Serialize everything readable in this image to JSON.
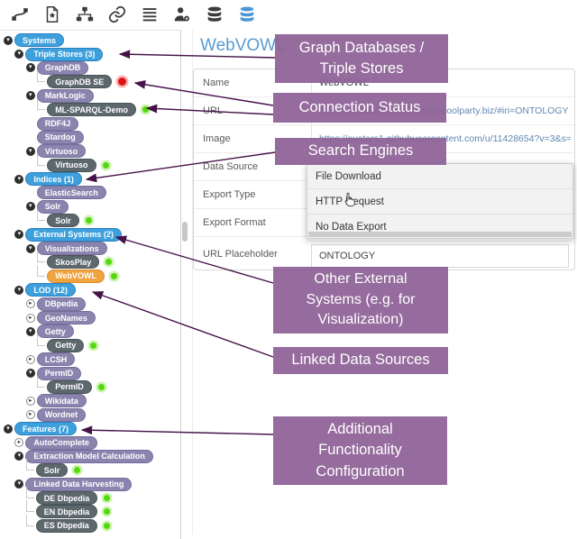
{
  "toolbar": {
    "icons": [
      {
        "name": "route",
        "active": false
      },
      {
        "name": "document-star",
        "active": false
      },
      {
        "name": "sitemap",
        "active": false
      },
      {
        "name": "link",
        "active": false
      },
      {
        "name": "list",
        "active": false
      },
      {
        "name": "user-gear",
        "active": false
      },
      {
        "name": "database",
        "active": false
      },
      {
        "name": "database-active",
        "active": true
      }
    ]
  },
  "tree": {
    "rows": [
      {
        "label": "Systems",
        "kind": "blue",
        "level": 0,
        "exp": "open",
        "status": null
      },
      {
        "label": "Triple Stores (3)",
        "kind": "blue",
        "level": 1,
        "exp": "open",
        "status": null
      },
      {
        "label": "GraphDB",
        "kind": "purple",
        "level": 2,
        "exp": "open",
        "status": null
      },
      {
        "label": "GraphDB SE",
        "kind": "dark",
        "level": 3,
        "exp": null,
        "status": "red"
      },
      {
        "label": "MarkLogic",
        "kind": "purple",
        "level": 2,
        "exp": "open",
        "status": null
      },
      {
        "label": "ML-SPARQL-Demo",
        "kind": "dark",
        "level": 3,
        "exp": null,
        "status": "green"
      },
      {
        "label": "RDF4J",
        "kind": "purple",
        "level": 2,
        "exp": null,
        "status": null
      },
      {
        "label": "Stardog",
        "kind": "purple",
        "level": 2,
        "exp": null,
        "status": null
      },
      {
        "label": "Virtuoso",
        "kind": "purple",
        "level": 2,
        "exp": "open",
        "status": null
      },
      {
        "label": "Virtuoso",
        "kind": "dark",
        "level": 3,
        "exp": null,
        "status": "green"
      },
      {
        "label": "Indices (1)",
        "kind": "blue",
        "level": 1,
        "exp": "open",
        "status": null
      },
      {
        "label": "ElasticSearch",
        "kind": "purple",
        "level": 2,
        "exp": null,
        "status": null
      },
      {
        "label": "Solr",
        "kind": "purple",
        "level": 2,
        "exp": "open",
        "status": null
      },
      {
        "label": "Solr",
        "kind": "dark",
        "level": 3,
        "exp": null,
        "status": "green"
      },
      {
        "label": "External Systems (2)",
        "kind": "blue",
        "level": 1,
        "exp": "open",
        "status": null
      },
      {
        "label": "Visualizations",
        "kind": "purple",
        "level": 2,
        "exp": "open",
        "status": null
      },
      {
        "label": "SkosPlay",
        "kind": "dark",
        "level": 3,
        "exp": null,
        "status": "green"
      },
      {
        "label": "WebVOWL",
        "kind": "orange",
        "level": 3,
        "exp": null,
        "status": "green"
      },
      {
        "label": "LOD (12)",
        "kind": "blue",
        "level": 1,
        "exp": "open",
        "status": null
      },
      {
        "label": "DBpedia",
        "kind": "purple",
        "level": 2,
        "exp": "closed",
        "status": null
      },
      {
        "label": "GeoNames",
        "kind": "purple",
        "level": 2,
        "exp": "closed",
        "status": null
      },
      {
        "label": "Getty",
        "kind": "purple",
        "level": 2,
        "exp": "open",
        "status": null
      },
      {
        "label": "Getty",
        "kind": "dark",
        "level": 3,
        "exp": null,
        "status": "green"
      },
      {
        "label": "LCSH",
        "kind": "purple",
        "level": 2,
        "exp": "closed",
        "status": null
      },
      {
        "label": "PermID",
        "kind": "purple",
        "level": 2,
        "exp": "open",
        "status": null
      },
      {
        "label": "PermID",
        "kind": "dark",
        "level": 3,
        "exp": null,
        "status": "green"
      },
      {
        "label": "Wikidata",
        "kind": "purple",
        "level": 2,
        "exp": "closed",
        "status": null
      },
      {
        "label": "Wordnet",
        "kind": "purple",
        "level": 2,
        "exp": "closed",
        "status": null
      },
      {
        "label": "Features (7)",
        "kind": "blue",
        "level": 0,
        "exp": "open",
        "status": null
      },
      {
        "label": "AutoComplete",
        "kind": "purple",
        "level": 1,
        "exp": "closed",
        "status": null
      },
      {
        "label": "Extraction Model Calculation",
        "kind": "purple",
        "level": 1,
        "exp": "open",
        "status": null
      },
      {
        "label": "Solr",
        "kind": "dark",
        "level": 2,
        "exp": null,
        "status": "green"
      },
      {
        "label": "Linked Data Harvesting",
        "kind": "purple",
        "level": 1,
        "exp": "open",
        "status": null
      },
      {
        "label": "DE Dbpedia",
        "kind": "dark",
        "level": 2,
        "exp": null,
        "status": "green"
      },
      {
        "label": "EN Dbpedia",
        "kind": "dark",
        "level": 2,
        "exp": null,
        "status": "green"
      },
      {
        "label": "ES Dbpedia",
        "kind": "dark",
        "level": 2,
        "exp": null,
        "status": "green"
      }
    ]
  },
  "detail": {
    "title": "WebVOWL",
    "fields": [
      {
        "label": "Name",
        "type": "text",
        "value": "WebVOWL"
      },
      {
        "label": "URL",
        "type": "link",
        "value": "https://visualization-webvowl.poolparty.biz/#iri=ONTOLOGY"
      },
      {
        "label": "Image",
        "type": "link",
        "value": "https://avatars1.githubusercontent.com/u/11428654?v=3&s=400"
      },
      {
        "label": "Data Source",
        "type": "empty",
        "value": ""
      },
      {
        "label": "Export Type",
        "type": "empty",
        "value": ""
      },
      {
        "label": "Export Format",
        "type": "empty",
        "value": ""
      },
      {
        "label": "URL Placeholder",
        "type": "input",
        "value": "ONTOLOGY"
      }
    ],
    "dropdown": {
      "options": [
        "File Download",
        "HTTP Request",
        "No Data Export"
      ],
      "hovered": "HTTP Request"
    }
  },
  "annotations": [
    {
      "text": "Graph Databases /\nTriple Stores"
    },
    {
      "text": "Connection Status"
    },
    {
      "text": "Search Engines"
    },
    {
      "text": "Other External\nSystems (e.g. for\nVisualization)"
    },
    {
      "text": "Linked Data Sources"
    },
    {
      "text": "Additional\nFunctionality\nConfiguration"
    }
  ],
  "colors": {
    "category_blue": "#3da0dc",
    "group_purple": "#8b84ae",
    "instance_dark": "#5d686d",
    "webvowl_orange": "#f0a440",
    "status_green": "#56d70f",
    "status_red": "#de1414",
    "annotation_purple": "#8d6196",
    "arrow": "#451247",
    "link_blue": "#5f87b0",
    "title_blue": "#5b9bd5",
    "active_icon_blue": "#4a97d6"
  }
}
